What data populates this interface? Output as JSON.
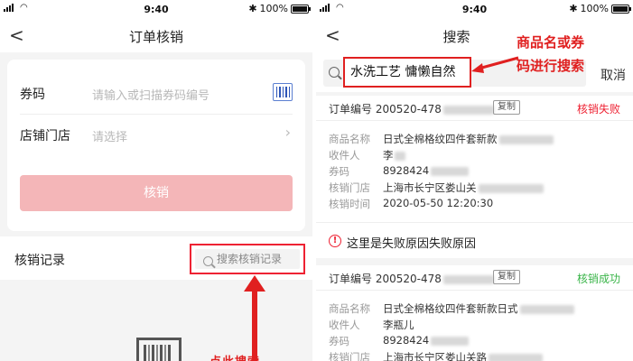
{
  "left": {
    "status": {
      "time": "9:40",
      "battery": "100%"
    },
    "nav": {
      "back": "<",
      "title": "订单核销"
    },
    "form": {
      "coupon_label": "券码",
      "coupon_placeholder": "请输入或扫描券码编号",
      "store_label": "店铺门店",
      "store_placeholder": "请选择",
      "verify_button": "核销"
    },
    "records": {
      "title": "核销记录",
      "search_placeholder": "搜索核销记录"
    },
    "annotation": "点此搜索"
  },
  "right": {
    "status": {
      "time": "9:40",
      "battery": "100%"
    },
    "nav": {
      "back": "<",
      "title": "搜索"
    },
    "search": {
      "query": "水洗工艺 慵懒自然",
      "cancel": "取消"
    },
    "annotation_line1": "商品名或券",
    "annotation_line2": "码进行搜索",
    "labels": {
      "order_no": "订单编号",
      "copy": "复制",
      "product": "商品名称",
      "receiver": "收件人",
      "coupon": "券码",
      "store": "核销门店",
      "time": "核销时间"
    },
    "orders": [
      {
        "no": "200520-478",
        "status": "核销失败",
        "product": "日式全棉格纹四件套新款",
        "receiver": "李",
        "coupon": "8928424",
        "store": "上海市长宁区娄山关",
        "time": "2020-05-50 12:20:30",
        "reason": "这里是失败原因失败原因"
      },
      {
        "no": "200520-478",
        "status": "核销成功",
        "product": "日式全棉格纹四件套新款日式",
        "receiver": "李瓶儿",
        "coupon": "8928424",
        "store": "上海市长宁区娄山关路"
      }
    ]
  }
}
